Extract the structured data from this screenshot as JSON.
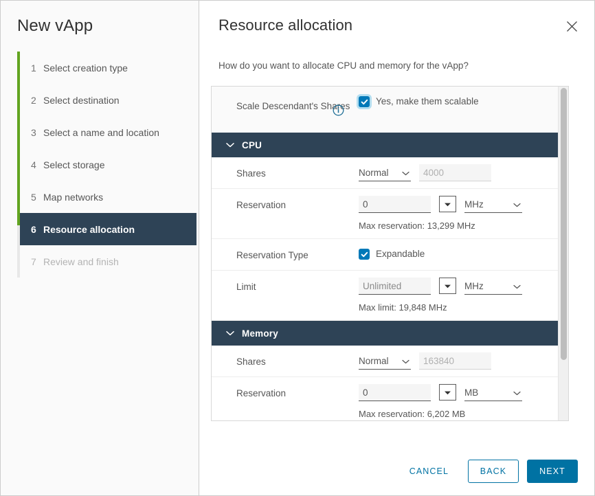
{
  "window": {
    "wizard_title": "New vApp"
  },
  "sidebar": {
    "steps": [
      {
        "num": "1",
        "label": "Select creation type",
        "state": "done"
      },
      {
        "num": "2",
        "label": "Select destination",
        "state": "done"
      },
      {
        "num": "3",
        "label": "Select a name and location",
        "state": "done"
      },
      {
        "num": "4",
        "label": "Select storage",
        "state": "done"
      },
      {
        "num": "5",
        "label": "Map networks",
        "state": "done"
      },
      {
        "num": "6",
        "label": "Resource allocation",
        "state": "active"
      },
      {
        "num": "7",
        "label": "Review and finish",
        "state": "disabled"
      }
    ]
  },
  "header": {
    "page_title": "Resource allocation",
    "close_icon": "close-icon"
  },
  "main": {
    "intro": "How do you want to allocate CPU and memory for the vApp?",
    "scale_shares": {
      "label": "Scale Descendant's Shares",
      "info_icon": "info-icon",
      "checkbox_label": "Yes, make them scalable",
      "checked": true
    },
    "sections": [
      {
        "name": "CPU",
        "expanded": true,
        "chevron_icon": "chevron-down-icon",
        "rows": [
          {
            "type": "shares",
            "label": "Shares",
            "select_value": "Normal",
            "amount_value": "4000",
            "amount_disabled": true
          },
          {
            "type": "reservation",
            "label": "Reservation",
            "value": "0",
            "unit": "MHz",
            "stepper_icon": "caret-down-icon",
            "hint": "Max reservation: 13,299 MHz"
          },
          {
            "type": "reservation_type",
            "label": "Reservation Type",
            "checkbox_label": "Expandable",
            "checked": true
          },
          {
            "type": "limit",
            "label": "Limit",
            "value": "Unlimited",
            "unit": "MHz",
            "stepper_icon": "caret-down-icon",
            "hint": "Max limit: 19,848 MHz"
          }
        ]
      },
      {
        "name": "Memory",
        "expanded": true,
        "chevron_icon": "chevron-down-icon",
        "rows": [
          {
            "type": "shares",
            "label": "Shares",
            "select_value": "Normal",
            "amount_value": "163840",
            "amount_disabled": true
          },
          {
            "type": "reservation",
            "label": "Reservation",
            "value": "0",
            "unit": "MB",
            "stepper_icon": "caret-down-icon",
            "hint": "Max reservation: 6,202 MB"
          }
        ]
      }
    ]
  },
  "footer": {
    "cancel_label": "CANCEL",
    "back_label": "BACK",
    "next_label": "NEXT"
  },
  "colors": {
    "accent": "#0072a3",
    "section_header": "#2e4356",
    "progress_green": "#62a420",
    "checkbox_blue": "#0079b8"
  }
}
